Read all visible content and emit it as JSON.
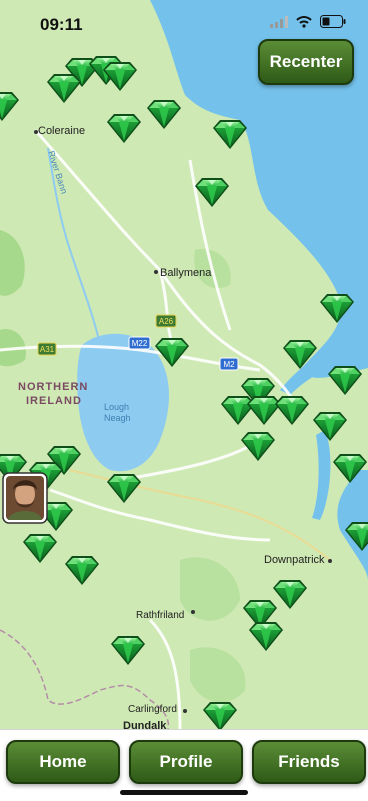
{
  "status_bar": {
    "time": "09:11"
  },
  "map": {
    "places": [
      {
        "name": "Coleraine"
      },
      {
        "name": "Ballymena"
      },
      {
        "name": "Downpatrick"
      },
      {
        "name": "Rathfriland"
      },
      {
        "name": "Carlingford"
      },
      {
        "name": "Dundalk"
      }
    ],
    "region_label_line1": "NORTHERN",
    "region_label_line2": "IRELAND",
    "lake_label_line1": "Lough",
    "lake_label_line2": "Neagh",
    "river_label": "River Bann",
    "road_shields": [
      {
        "label": "A26"
      },
      {
        "label": "M22"
      },
      {
        "label": "M2"
      },
      {
        "label": "A31"
      }
    ],
    "marker_icon": "green-gem-icon",
    "player_avatar_icon": "player-avatar-icon"
  },
  "buttons": {
    "recenter": "Recenter"
  },
  "nav": {
    "home": "Home",
    "profile": "Profile",
    "friends": "Friends"
  },
  "colors": {
    "land": "#cfe9b4",
    "sea": "#74c2ec",
    "lake": "#8dcbf0",
    "button_green": "#3f7322",
    "gem": "#1fa83a"
  }
}
